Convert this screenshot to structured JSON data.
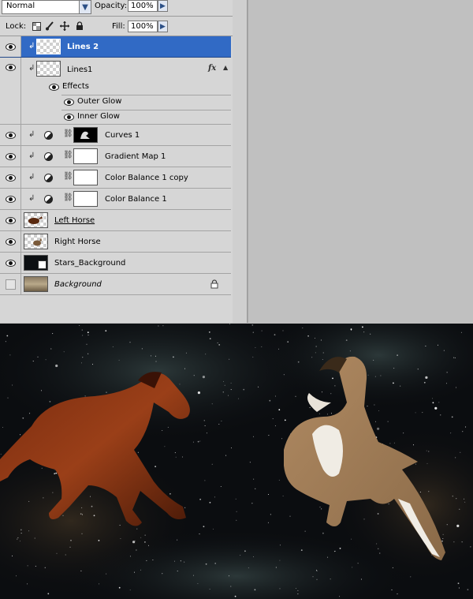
{
  "toolbar": {
    "blend_mode": "Normal",
    "opacity_label": "Opacity:",
    "opacity_value": "100%",
    "lock_label": "Lock:",
    "fill_label": "Fill:",
    "fill_value": "100%"
  },
  "layers": [
    {
      "name": "Lines 2",
      "visible": true,
      "selected": true,
      "thumb": "checker"
    },
    {
      "name": "Lines1",
      "visible": true,
      "fx": "fx",
      "thumb": "checker"
    },
    {
      "name": "Effects",
      "visible": true
    },
    {
      "name": "Outer Glow",
      "visible": true
    },
    {
      "name": "Inner Glow",
      "visible": true
    },
    {
      "name": "Curves 1",
      "visible": true
    },
    {
      "name": "Gradient Map 1",
      "visible": true
    },
    {
      "name": "Color Balance 1 copy",
      "visible": true
    },
    {
      "name": "Color Balance 1",
      "visible": true
    },
    {
      "name": "Left Horse",
      "visible": true
    },
    {
      "name": "Right Horse",
      "visible": true
    },
    {
      "name": "Stars_Background",
      "visible": true
    },
    {
      "name": "Background",
      "visible": false,
      "locked": true
    }
  ],
  "colors": {
    "panel_bg": "#d6d6d6",
    "selected_row": "#316ac5",
    "space_bg": "#0b0d10"
  }
}
